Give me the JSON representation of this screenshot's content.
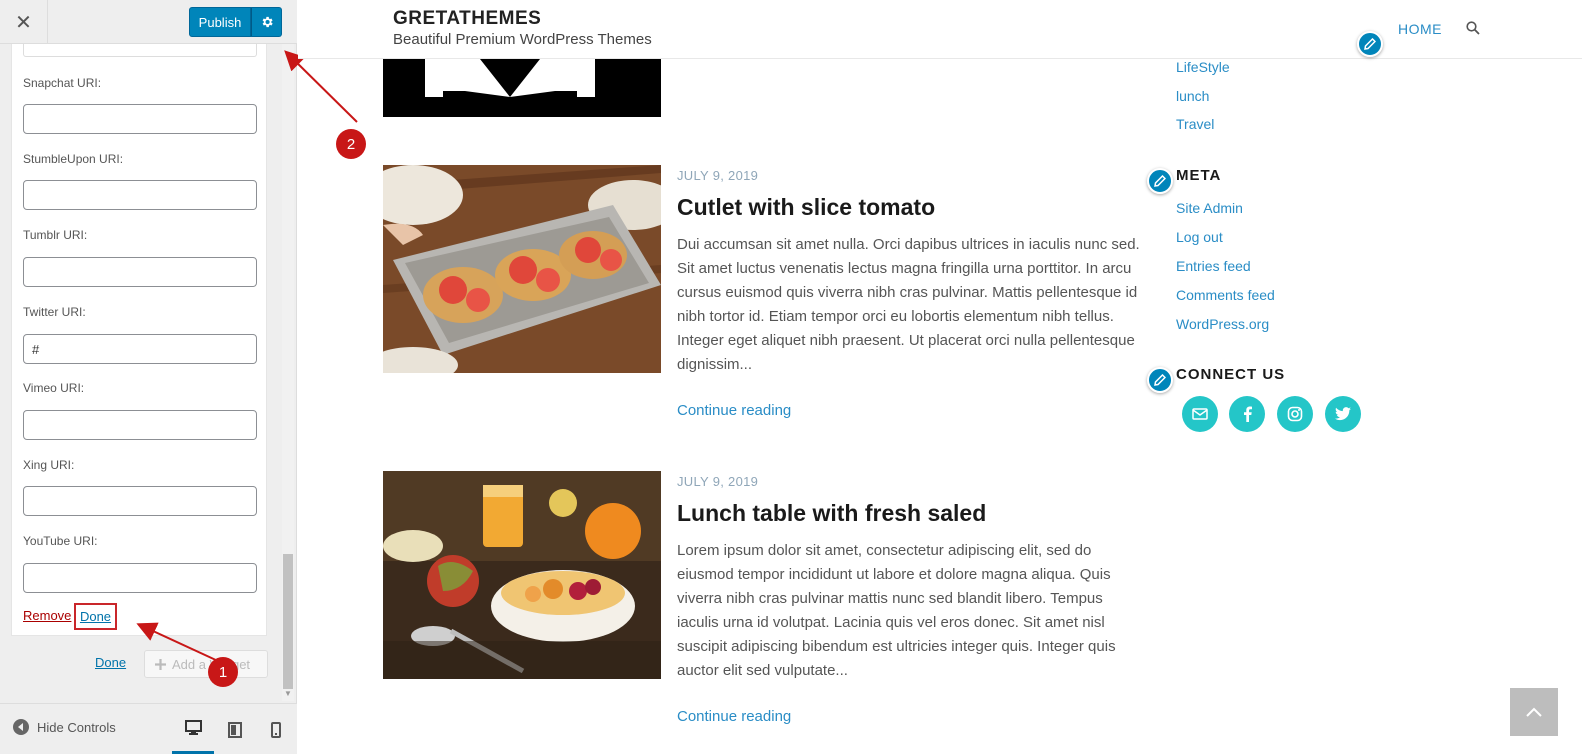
{
  "customizer": {
    "close_glyph": "✕",
    "publish_label": "Publish",
    "fields": [
      {
        "label": "Snapchat URI:",
        "value": ""
      },
      {
        "label": "StumbleUpon URI:",
        "value": ""
      },
      {
        "label": "Tumblr URI:",
        "value": ""
      },
      {
        "label": "Twitter URI:",
        "value": "#"
      },
      {
        "label": "Vimeo URI:",
        "value": ""
      },
      {
        "label": "Xing URI:",
        "value": ""
      },
      {
        "label": "YouTube URI:",
        "value": ""
      }
    ],
    "remove_label": "Remove",
    "done_label": "Done",
    "outer_done_label": "Done",
    "add_widget_label": "Add a Widget",
    "hide_controls_label": "Hide Controls"
  },
  "annotations": {
    "badge_1": "1",
    "badge_2": "2",
    "color": "#c81717"
  },
  "site": {
    "title": "GRETATHEMES",
    "tagline": "Beautiful Premium WordPress Themes",
    "nav_home": "HOME"
  },
  "posts": [
    {
      "date": "JULY 9, 2019",
      "title": "Cutlet with slice tomato",
      "excerpt": "Dui accumsan sit amet nulla. Orci dapibus ultrices in iaculis nunc sed. Sit amet luctus venenatis lectus magna fringilla urna porttitor. In arcu cursus euismod quis viverra nibh cras pulvinar. Mattis pellentesque id nibh tortor id. Etiam tempor orci eu lobortis elementum nibh tellus. Integer eget aliquet nibh praesent. Ut placerat orci nulla pellentesque dignissim...",
      "continue": "Continue reading"
    },
    {
      "date": "JULY 9, 2019",
      "title": "Lunch table with fresh saled",
      "excerpt": "Lorem ipsum dolor sit amet, consectetur adipiscing elit, sed do eiusmod tempor incididunt ut labore et dolore magna aliqua. Quis viverra nibh cras pulvinar mattis nunc sed blandit libero. Tempus iaculis urna id volutpat. Lacinia quis vel eros donec. Sit amet nisl suscipit adipiscing bibendum est ultricies integer quis. Integer quis auctor elit sed vulputate...",
      "continue": "Continue reading"
    }
  ],
  "sidebar": {
    "categories": [
      "LifeStyle",
      "lunch",
      "Travel"
    ],
    "meta_heading": "META",
    "meta_links": [
      "Site Admin",
      "Log out",
      "Entries feed",
      "Comments feed",
      "WordPress.org"
    ],
    "connect_heading": "CONNECT US",
    "social_icons": [
      "email-icon",
      "facebook-icon",
      "instagram-icon",
      "twitter-icon"
    ]
  },
  "colors": {
    "primary": "#0085ba",
    "link": "#2a8dc6",
    "social": "#24c6c8",
    "annotation": "#c81717"
  }
}
